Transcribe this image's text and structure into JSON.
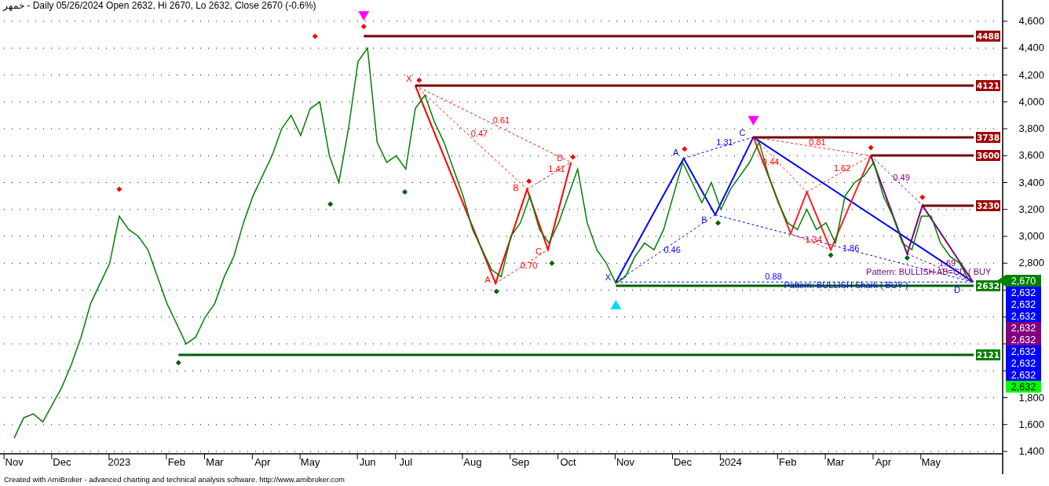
{
  "title": "خمهر - Daily 05/26/2024 Open 2632, Hi 2670, Lo 2632, Close 2670 (-0.6%)",
  "chart": {
    "chart_data": {
      "type": "line",
      "ylim": [
        1382.5,
        4757.7
      ],
      "categories": [
        "Nov",
        null,
        null,
        null,
        null,
        "Dec",
        null,
        null,
        null,
        null,
        null,
        "2023",
        null,
        null,
        null,
        null,
        null,
        "Feb",
        null,
        null,
        null,
        "Mar",
        null,
        null,
        null,
        null,
        "Apr",
        null,
        null,
        null,
        null,
        "May",
        null,
        null,
        null,
        null,
        null,
        "Jun",
        null,
        null,
        null,
        "Jul",
        null,
        null,
        null,
        null,
        null,
        null,
        "Aug",
        null,
        null,
        null,
        null,
        "Sep",
        null,
        null,
        null,
        null,
        "Oct",
        null,
        null,
        null,
        null,
        null,
        "Nov",
        null,
        null,
        null,
        null,
        null,
        "Dec",
        null,
        null,
        null,
        null,
        "2024",
        null,
        null,
        null,
        null,
        null,
        "Feb",
        null,
        null,
        null,
        null,
        "Mar",
        null,
        null,
        null,
        null,
        "Apr",
        null,
        null,
        null,
        null,
        "May",
        null,
        null,
        null,
        null,
        null,
        null,
        null
      ],
      "grid": true,
      "series": [
        {
          "color": "#008000",
          "values": [
            1500,
            1650,
            1680,
            1620,
            1750,
            1880,
            2050,
            2250,
            2500,
            2650,
            2800,
            3150,
            3050,
            3000,
            2900,
            2700,
            2500,
            2350,
            2200,
            2250,
            2400,
            2500,
            2700,
            2850,
            3100,
            3300,
            3450,
            3600,
            3800,
            3900,
            3750,
            3950,
            4000,
            3600,
            3400,
            3800,
            4300,
            4400,
            3700,
            3550,
            3600,
            3500,
            3950,
            4050,
            3850,
            3700,
            3500,
            3300,
            3050,
            2900,
            2750,
            2700,
            3000,
            3100,
            3300,
            3050,
            2950,
            3100,
            3300,
            3500,
            3100,
            2900,
            2800,
            2650,
            2700,
            2850,
            2950,
            2900,
            3050,
            3300,
            3550,
            3400,
            3250,
            3400,
            3200,
            3350,
            3450,
            3550,
            3700,
            3450,
            3250,
            3100,
            3050,
            3200,
            3050,
            3100,
            2950,
            3300,
            3400,
            3450,
            3550,
            3300,
            3150,
            2950,
            2900,
            3150,
            3150,
            2950,
            2850,
            2800,
            2670,
            null,
            null,
            null
          ]
        }
      ],
      "yticks": [
        {
          "value": 1400,
          "label": "1,400"
        },
        {
          "value": 1600,
          "label": "1,600"
        },
        {
          "value": 1800,
          "label": "1,800"
        },
        {
          "value": 2800,
          "label": "2,800"
        },
        {
          "value": 3000,
          "label": "3,000"
        },
        {
          "value": 3200,
          "label": "3,200"
        },
        {
          "value": 3400,
          "label": "3,400"
        },
        {
          "value": 3600,
          "label": "3,600"
        },
        {
          "value": 3800,
          "label": "3,800"
        },
        {
          "value": 4000,
          "label": "4,000"
        },
        {
          "value": 4200,
          "label": "4,200"
        },
        {
          "value": 4400,
          "label": "4,400"
        },
        {
          "value": 4600,
          "label": "4,600"
        }
      ]
    },
    "levels": [
      {
        "label": "4488",
        "color": "#a00000"
      },
      {
        "label": "4121",
        "color": "#a00000"
      },
      {
        "label": "3738",
        "color": "#a00000"
      },
      {
        "label": "3600",
        "color": "#a00000"
      },
      {
        "label": "3230",
        "color": "#a00000"
      },
      {
        "label": "2632",
        "color": "#008000"
      },
      {
        "label": "2121",
        "color": "#008000"
      }
    ],
    "ratios": [
      "0.61",
      "0.47",
      "1.41",
      "0.70",
      "1.31",
      "0.46",
      "1.86",
      "0.88",
      "0.81",
      "0.44",
      "1.62",
      "1.34",
      "0.49",
      "1.69"
    ],
    "point_labels": [
      "X",
      "A",
      "B",
      "C",
      "D",
      "X",
      "A",
      "B",
      "C",
      "D"
    ],
    "pattern_labels": [
      "Pattern: BULLISH Shark ( BUY )",
      "Pattern: BULLISH AB=CD ( BUY"
    ]
  },
  "price_tags": [
    {
      "label": "2,670",
      "color": "#008000",
      "kind": "pointer"
    },
    {
      "label": "2,632",
      "color": "#0000ff",
      "kind": "box"
    },
    {
      "label": "2,632",
      "color": "#0000ff",
      "kind": "box"
    },
    {
      "label": "2,632",
      "color": "#0000ff",
      "kind": "box"
    },
    {
      "label": "2,632",
      "color": "#800080",
      "kind": "box"
    },
    {
      "label": "2,632",
      "color": "#800080",
      "kind": "box"
    },
    {
      "label": "2,632",
      "color": "#0000ff",
      "kind": "box"
    },
    {
      "label": "2,632",
      "color": "#0000ff",
      "kind": "box"
    },
    {
      "label": "2,632",
      "color": "#0000ff",
      "kind": "box"
    },
    {
      "label": "2,632",
      "color": "#00ff00",
      "kind": "box"
    }
  ],
  "footer": "Created with AmiBroker - advanced charting and technical analysis software. http://www.amibroker.com"
}
